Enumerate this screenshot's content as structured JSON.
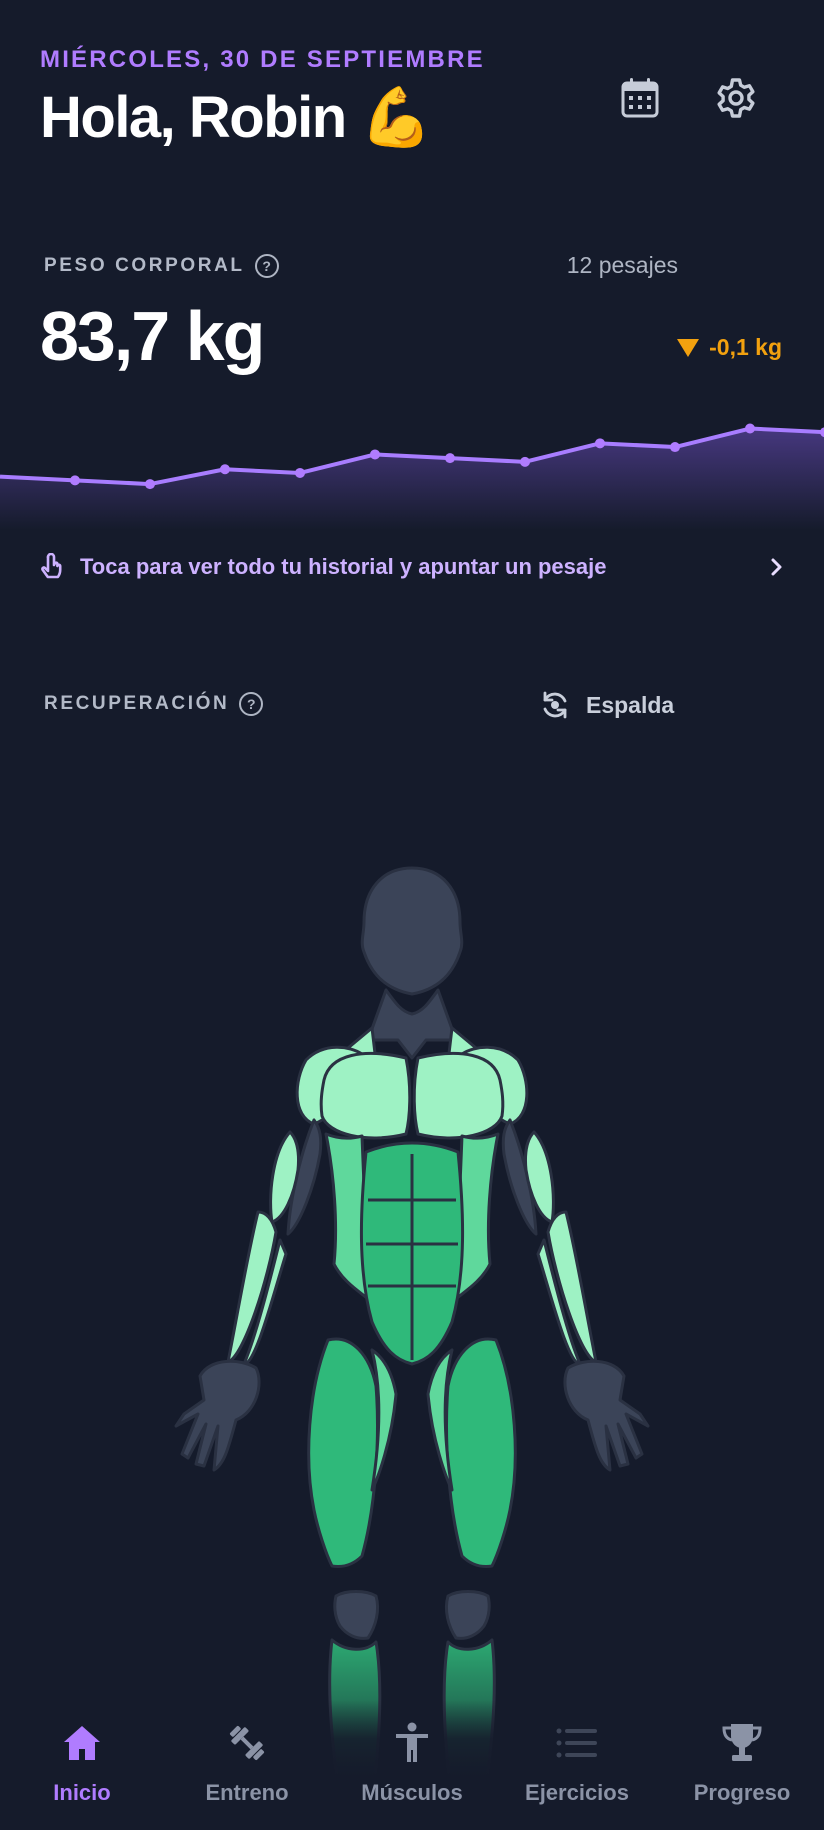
{
  "header": {
    "date": "MIÉRCOLES, 30 DE SEPTIEMBRE",
    "greeting": "Hola, Robin 💪",
    "calendar_icon": "calendar-icon",
    "settings_icon": "gear-icon"
  },
  "weight": {
    "label": "PESO CORPORAL",
    "help": "?",
    "count": "12 pesajes",
    "value": "83,7 kg",
    "delta": "-0,1 kg",
    "accent": "#b07cff",
    "delta_color": "#f2a10f"
  },
  "chart_data": {
    "type": "line",
    "title": "",
    "series": [
      {
        "values": [
          83.8,
          83.7,
          83.6,
          84.0,
          83.9,
          84.4,
          84.3,
          84.2,
          84.7,
          84.6,
          85.1,
          85.0
        ]
      }
    ],
    "ylim": [
      82.9,
      85.6
    ],
    "grid": false
  },
  "history_link": {
    "text": "Toca para ver todo tu historial y apuntar un pesaje",
    "icon": "touch-icon",
    "chevron": "chevron-right-icon"
  },
  "recovery": {
    "label": "RECUPERACIÓN",
    "help": "?",
    "view_toggle": "Espalda",
    "toggle_icon": "rotate-view-icon",
    "colors": {
      "fresh": "#9ef2c4",
      "mid": "#5fd89c",
      "recovering": "#2fb97a",
      "inactive": "#3b4458"
    }
  },
  "nav": {
    "items": [
      {
        "label": "Inicio",
        "icon": "home-icon",
        "active": true
      },
      {
        "label": "Entreno",
        "icon": "dumbbell-icon",
        "active": false
      },
      {
        "label": "Músculos",
        "icon": "person-icon",
        "active": false
      },
      {
        "label": "Ejercicios",
        "icon": "list-icon",
        "active": false
      },
      {
        "label": "Progreso",
        "icon": "trophy-icon",
        "active": false
      }
    ]
  }
}
